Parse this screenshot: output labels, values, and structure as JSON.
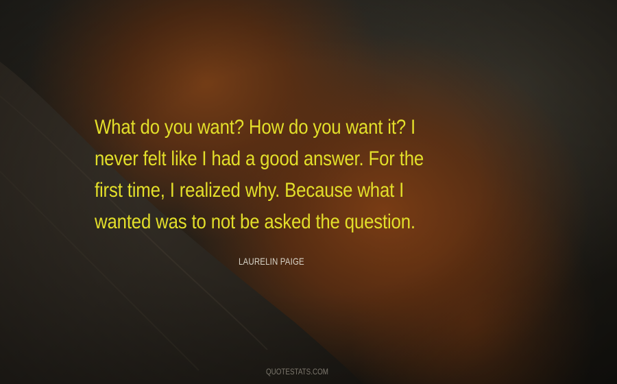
{
  "quote": {
    "lines": [
      "What do you want? How do you want it? I",
      "never felt like I had a good answer. For the",
      "first time, I realized why. Because what I",
      "wanted was to not be asked the question."
    ]
  },
  "author": "LAURELIN PAIGE",
  "watermark": "QUOTESTATS.COM",
  "colors": {
    "quote_text": "#e3df2a",
    "author_text": "#d8d4c8",
    "watermark_text": "#7d786e",
    "background": "#24211b"
  }
}
